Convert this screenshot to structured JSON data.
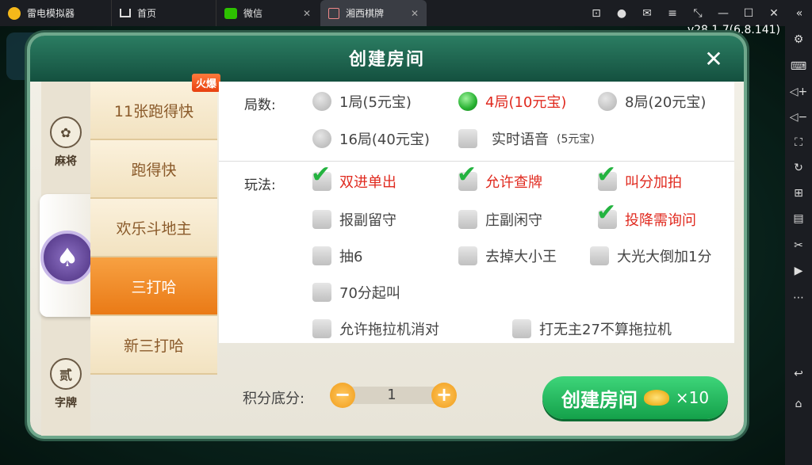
{
  "emulator": {
    "app_name": "雷电模拟器",
    "tabs": [
      {
        "label": "首页"
      },
      {
        "label": "微信"
      },
      {
        "label": "湘西棋牌"
      }
    ],
    "version": "v28.1.7(6.8.141)"
  },
  "dialog": {
    "title": "创建房间",
    "categories": [
      {
        "label": "麻将",
        "icon": "mahjong-medal-icon"
      },
      {
        "label": "",
        "icon": "poker-spade-icon"
      },
      {
        "label": "字牌",
        "icon": "zipai-medal-icon",
        "glyph": "贰"
      }
    ],
    "games": [
      {
        "label": "11张跑得快",
        "badge": "火爆"
      },
      {
        "label": "跑得快"
      },
      {
        "label": "欢乐斗地主"
      },
      {
        "label": "三打哈"
      },
      {
        "label": "新三打哈"
      }
    ],
    "rounds": {
      "label": "局数:",
      "options": [
        {
          "label": "1局(5元宝)",
          "selected": false
        },
        {
          "label": "4局(10元宝)",
          "selected": true
        },
        {
          "label": "8局(20元宝)",
          "selected": false
        },
        {
          "label": "16局(40元宝)",
          "selected": false
        }
      ],
      "voice": {
        "label": "实时语音",
        "note": "(5元宝)",
        "checked": false
      }
    },
    "rules": {
      "label": "玩法:",
      "options": [
        {
          "label": "双进单出",
          "checked": true
        },
        {
          "label": "允许查牌",
          "checked": true
        },
        {
          "label": "叫分加拍",
          "checked": true
        },
        {
          "label": "报副留守",
          "checked": false
        },
        {
          "label": "庄副闲守",
          "checked": false
        },
        {
          "label": "投降需询问",
          "checked": true
        },
        {
          "label": "抽6",
          "checked": false
        },
        {
          "label": "去掉大小王",
          "checked": false
        },
        {
          "label": "大光大倒加1分",
          "checked": false
        },
        {
          "label": "70分起叫",
          "checked": false
        },
        {
          "label": "允许拖拉机消对",
          "checked": false
        },
        {
          "label": "打无主27不算拖拉机",
          "checked": false
        }
      ]
    },
    "score": {
      "label": "积分底分:",
      "value": "1",
      "minus": "−",
      "plus": "+"
    },
    "create_button": {
      "label": "创建房间",
      "cost": "×10"
    }
  }
}
